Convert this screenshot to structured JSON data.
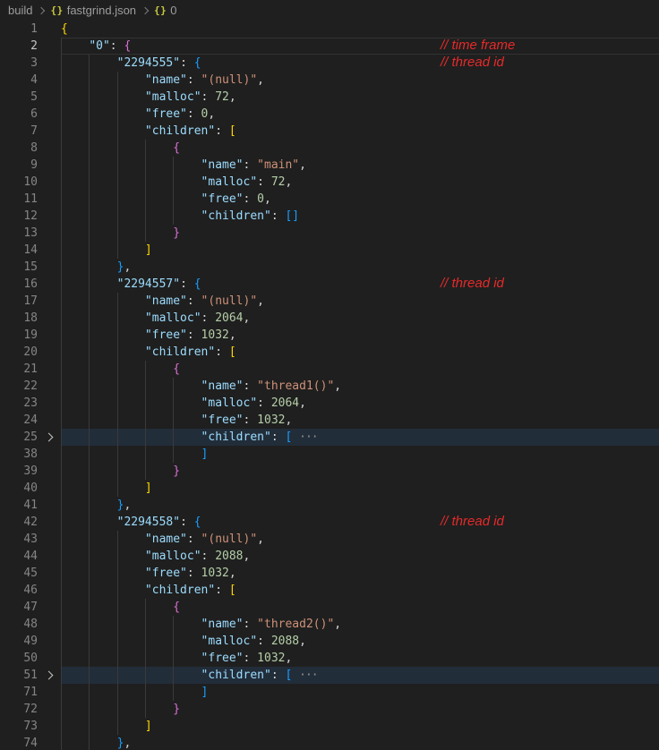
{
  "breadcrumb": {
    "icon_glyph": "{}",
    "items": [
      {
        "label": "build"
      },
      {
        "label": "fastgrind.json"
      },
      {
        "label": "0"
      }
    ]
  },
  "colors": {
    "editor_background": "#1f1f1f",
    "fold_highlight_background": "#222d3a",
    "key": "#9cdcfe",
    "string": "#ce9178",
    "number": "#b5cea8",
    "bracket_level_1": "#ffd700",
    "bracket_level_2": "#da70d6",
    "bracket_level_3": "#179fff",
    "line_number": "#858585",
    "annotation_red": "#e62a2a"
  },
  "editor": {
    "lines": [
      {
        "n": 1,
        "indent": 0,
        "tokens": [
          [
            "b1",
            "{"
          ]
        ]
      },
      {
        "n": 2,
        "indent": 1,
        "tokens": [
          [
            "key",
            "\"0\""
          ],
          [
            "pun",
            ": "
          ],
          [
            "b2",
            "{"
          ]
        ],
        "note": "// time frame",
        "current": true
      },
      {
        "n": 3,
        "indent": 2,
        "tokens": [
          [
            "key",
            "\"2294555\""
          ],
          [
            "pun",
            ": "
          ],
          [
            "b3",
            "{"
          ]
        ],
        "note": "// thread id"
      },
      {
        "n": 4,
        "indent": 3,
        "tokens": [
          [
            "key",
            "\"name\""
          ],
          [
            "pun",
            ": "
          ],
          [
            "str",
            "\"(null)\""
          ],
          [
            "pun",
            ","
          ]
        ]
      },
      {
        "n": 5,
        "indent": 3,
        "tokens": [
          [
            "key",
            "\"malloc\""
          ],
          [
            "pun",
            ": "
          ],
          [
            "num",
            "72"
          ],
          [
            "pun",
            ","
          ]
        ]
      },
      {
        "n": 6,
        "indent": 3,
        "tokens": [
          [
            "key",
            "\"free\""
          ],
          [
            "pun",
            ": "
          ],
          [
            "num",
            "0"
          ],
          [
            "pun",
            ","
          ]
        ]
      },
      {
        "n": 7,
        "indent": 3,
        "tokens": [
          [
            "key",
            "\"children\""
          ],
          [
            "pun",
            ": "
          ],
          [
            "b1",
            "["
          ]
        ]
      },
      {
        "n": 8,
        "indent": 4,
        "tokens": [
          [
            "b2",
            "{"
          ]
        ]
      },
      {
        "n": 9,
        "indent": 5,
        "tokens": [
          [
            "key",
            "\"name\""
          ],
          [
            "pun",
            ": "
          ],
          [
            "str",
            "\"main\""
          ],
          [
            "pun",
            ","
          ]
        ]
      },
      {
        "n": 10,
        "indent": 5,
        "tokens": [
          [
            "key",
            "\"malloc\""
          ],
          [
            "pun",
            ": "
          ],
          [
            "num",
            "72"
          ],
          [
            "pun",
            ","
          ]
        ]
      },
      {
        "n": 11,
        "indent": 5,
        "tokens": [
          [
            "key",
            "\"free\""
          ],
          [
            "pun",
            ": "
          ],
          [
            "num",
            "0"
          ],
          [
            "pun",
            ","
          ]
        ]
      },
      {
        "n": 12,
        "indent": 5,
        "tokens": [
          [
            "key",
            "\"children\""
          ],
          [
            "pun",
            ": "
          ],
          [
            "b3",
            "[]"
          ]
        ]
      },
      {
        "n": 13,
        "indent": 4,
        "tokens": [
          [
            "b2",
            "}"
          ]
        ]
      },
      {
        "n": 14,
        "indent": 3,
        "tokens": [
          [
            "b1",
            "]"
          ]
        ]
      },
      {
        "n": 15,
        "indent": 2,
        "tokens": [
          [
            "b3",
            "}"
          ],
          [
            "pun",
            ","
          ]
        ]
      },
      {
        "n": 16,
        "indent": 2,
        "tokens": [
          [
            "key",
            "\"2294557\""
          ],
          [
            "pun",
            ": "
          ],
          [
            "b3",
            "{"
          ]
        ],
        "note": "// thread id"
      },
      {
        "n": 17,
        "indent": 3,
        "tokens": [
          [
            "key",
            "\"name\""
          ],
          [
            "pun",
            ": "
          ],
          [
            "str",
            "\"(null)\""
          ],
          [
            "pun",
            ","
          ]
        ]
      },
      {
        "n": 18,
        "indent": 3,
        "tokens": [
          [
            "key",
            "\"malloc\""
          ],
          [
            "pun",
            ": "
          ],
          [
            "num",
            "2064"
          ],
          [
            "pun",
            ","
          ]
        ]
      },
      {
        "n": 19,
        "indent": 3,
        "tokens": [
          [
            "key",
            "\"free\""
          ],
          [
            "pun",
            ": "
          ],
          [
            "num",
            "1032"
          ],
          [
            "pun",
            ","
          ]
        ]
      },
      {
        "n": 20,
        "indent": 3,
        "tokens": [
          [
            "key",
            "\"children\""
          ],
          [
            "pun",
            ": "
          ],
          [
            "b1",
            "["
          ]
        ]
      },
      {
        "n": 21,
        "indent": 4,
        "tokens": [
          [
            "b2",
            "{"
          ]
        ]
      },
      {
        "n": 22,
        "indent": 5,
        "tokens": [
          [
            "key",
            "\"name\""
          ],
          [
            "pun",
            ": "
          ],
          [
            "str",
            "\"thread1()\""
          ],
          [
            "pun",
            ","
          ]
        ]
      },
      {
        "n": 23,
        "indent": 5,
        "tokens": [
          [
            "key",
            "\"malloc\""
          ],
          [
            "pun",
            ": "
          ],
          [
            "num",
            "2064"
          ],
          [
            "pun",
            ","
          ]
        ]
      },
      {
        "n": 24,
        "indent": 5,
        "tokens": [
          [
            "key",
            "\"free\""
          ],
          [
            "pun",
            ": "
          ],
          [
            "num",
            "1032"
          ],
          [
            "pun",
            ","
          ]
        ]
      },
      {
        "n": 25,
        "indent": 5,
        "tokens": [
          [
            "key",
            "\"children\""
          ],
          [
            "pun",
            ": "
          ],
          [
            "b3",
            "["
          ],
          [
            "pun",
            " "
          ],
          [
            "dots",
            "···"
          ]
        ],
        "folded": true,
        "highlight": true
      },
      {
        "n": 38,
        "indent": 5,
        "tokens": [
          [
            "b3",
            "]"
          ]
        ]
      },
      {
        "n": 39,
        "indent": 4,
        "tokens": [
          [
            "b2",
            "}"
          ]
        ]
      },
      {
        "n": 40,
        "indent": 3,
        "tokens": [
          [
            "b1",
            "]"
          ]
        ]
      },
      {
        "n": 41,
        "indent": 2,
        "tokens": [
          [
            "b3",
            "}"
          ],
          [
            "pun",
            ","
          ]
        ]
      },
      {
        "n": 42,
        "indent": 2,
        "tokens": [
          [
            "key",
            "\"2294558\""
          ],
          [
            "pun",
            ": "
          ],
          [
            "b3",
            "{"
          ]
        ],
        "note": "// thread id"
      },
      {
        "n": 43,
        "indent": 3,
        "tokens": [
          [
            "key",
            "\"name\""
          ],
          [
            "pun",
            ": "
          ],
          [
            "str",
            "\"(null)\""
          ],
          [
            "pun",
            ","
          ]
        ]
      },
      {
        "n": 44,
        "indent": 3,
        "tokens": [
          [
            "key",
            "\"malloc\""
          ],
          [
            "pun",
            ": "
          ],
          [
            "num",
            "2088"
          ],
          [
            "pun",
            ","
          ]
        ]
      },
      {
        "n": 45,
        "indent": 3,
        "tokens": [
          [
            "key",
            "\"free\""
          ],
          [
            "pun",
            ": "
          ],
          [
            "num",
            "1032"
          ],
          [
            "pun",
            ","
          ]
        ]
      },
      {
        "n": 46,
        "indent": 3,
        "tokens": [
          [
            "key",
            "\"children\""
          ],
          [
            "pun",
            ": "
          ],
          [
            "b1",
            "["
          ]
        ]
      },
      {
        "n": 47,
        "indent": 4,
        "tokens": [
          [
            "b2",
            "{"
          ]
        ]
      },
      {
        "n": 48,
        "indent": 5,
        "tokens": [
          [
            "key",
            "\"name\""
          ],
          [
            "pun",
            ": "
          ],
          [
            "str",
            "\"thread2()\""
          ],
          [
            "pun",
            ","
          ]
        ]
      },
      {
        "n": 49,
        "indent": 5,
        "tokens": [
          [
            "key",
            "\"malloc\""
          ],
          [
            "pun",
            ": "
          ],
          [
            "num",
            "2088"
          ],
          [
            "pun",
            ","
          ]
        ]
      },
      {
        "n": 50,
        "indent": 5,
        "tokens": [
          [
            "key",
            "\"free\""
          ],
          [
            "pun",
            ": "
          ],
          [
            "num",
            "1032"
          ],
          [
            "pun",
            ","
          ]
        ]
      },
      {
        "n": 51,
        "indent": 5,
        "tokens": [
          [
            "key",
            "\"children\""
          ],
          [
            "pun",
            ": "
          ],
          [
            "b3",
            "["
          ],
          [
            "pun",
            " "
          ],
          [
            "dots",
            "···"
          ]
        ],
        "folded": true,
        "highlight": true
      },
      {
        "n": 71,
        "indent": 5,
        "tokens": [
          [
            "b3",
            "]"
          ]
        ]
      },
      {
        "n": 72,
        "indent": 4,
        "tokens": [
          [
            "b2",
            "}"
          ]
        ]
      },
      {
        "n": 73,
        "indent": 3,
        "tokens": [
          [
            "b1",
            "]"
          ]
        ]
      },
      {
        "n": 74,
        "indent": 2,
        "tokens": [
          [
            "b3",
            "}"
          ],
          [
            "pun",
            ","
          ]
        ]
      }
    ]
  }
}
